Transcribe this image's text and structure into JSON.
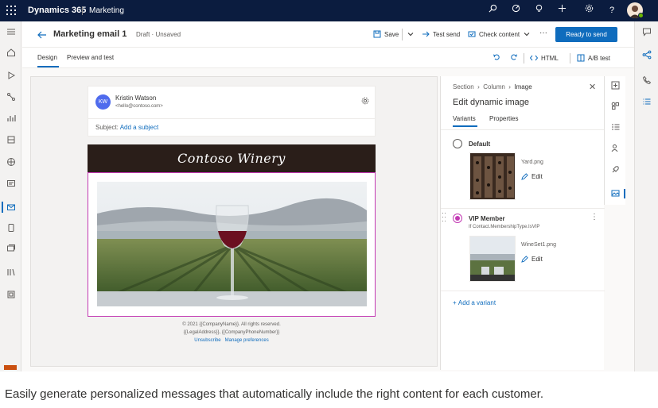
{
  "topbar": {
    "brand": "Dynamics 365",
    "app": "Marketing",
    "icons": [
      "waffle-icon",
      "search-icon",
      "target-icon",
      "lightbulb-icon",
      "plus-icon",
      "gear-icon",
      "help-icon",
      "avatar"
    ]
  },
  "left_nav": {
    "icons": [
      "hamburger-icon",
      "home-icon",
      "play-icon",
      "journeys-icon",
      "analytics-icon",
      "segments-icon",
      "globe-icon",
      "forms-icon",
      "email-icon",
      "channels-icon",
      "content-icon",
      "library-icon",
      "assets-icon"
    ],
    "active": "email-icon"
  },
  "right_rail": {
    "icons": [
      "chat-icon",
      "share-icon",
      "phone-icon",
      "list-icon"
    ]
  },
  "command_bar": {
    "title": "Marketing email 1",
    "status": "Draft · Unsaved",
    "save": "Save",
    "test_send": "Test send",
    "check_content": "Check content",
    "more": "···",
    "ready": "Ready to send"
  },
  "sub_bar": {
    "tabs": [
      "Design",
      "Preview and test"
    ],
    "active_tab": "Design",
    "html": "HTML",
    "ab_test": "A/B test"
  },
  "email": {
    "initials": "KW",
    "sender_name": "Kristin Watson",
    "sender_email": "<hello@contoso.com>",
    "subject_label": "Subject:",
    "subject_placeholder": "Add a subject",
    "banner": "Contoso Winery",
    "footer_line1": "© 2021 {{CompanyName}}. All rights reserved.",
    "footer_line2": "{{LegalAddress}}, {{CompanyPhoneNumber}}",
    "unsubscribe": "Unsubscribe",
    "manage_prefs": "Manage preferences"
  },
  "panel": {
    "breadcrumb": [
      "Section",
      "Column",
      "Image"
    ],
    "title": "Edit dynamic image",
    "tabs": [
      "Variants",
      "Properties"
    ],
    "active_tab": "Variants",
    "variants": [
      {
        "label": "Default",
        "condition": "",
        "file": "Yard.png",
        "edit": "Edit",
        "selected": false
      },
      {
        "label": "VIP Member",
        "condition": "If Contact.MembershipType.IsVIP",
        "file": "WineSet1.png",
        "edit": "Edit",
        "selected": true
      }
    ],
    "add_variant": "Add a variant",
    "tool_icons": [
      "add-element-icon",
      "sections-icon",
      "text-style-icon",
      "personalize-icon",
      "rocket-icon",
      "image-icon"
    ]
  },
  "caption": "Easily generate personalized messages that automatically include the right content for each customer.",
  "colors": {
    "topbar": "#0b1c3f",
    "accent": "#0f6cbd",
    "selection": "#c239b3",
    "banner": "#2a1e19"
  }
}
